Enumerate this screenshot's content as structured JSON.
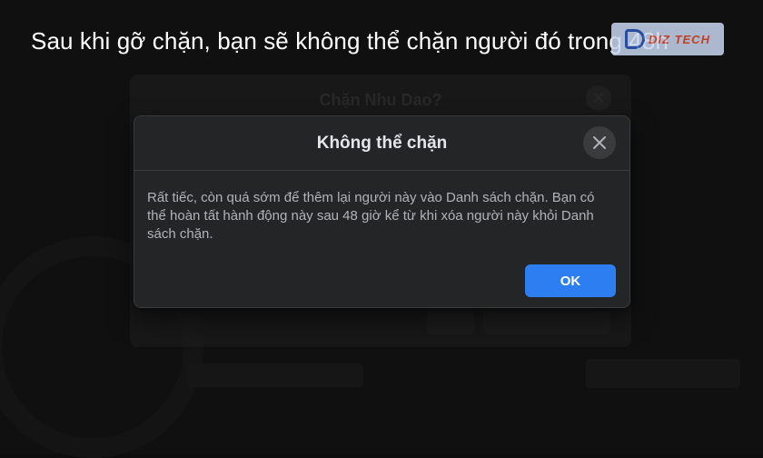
{
  "caption": "Sau khi gỡ chặn, bạn sẽ không thể chặn người đó trong 48h",
  "logo": {
    "text": "DIZ TECH"
  },
  "background": {
    "dialog_title": "Chặn Nhu Dao?",
    "close_glyph": "✕"
  },
  "dialog": {
    "title": "Không thể chặn",
    "close_icon": "close-icon",
    "message": "Rất tiếc, còn quá sớm để thêm lại người này vào Danh sách chặn. Bạn có thể hoàn tất hành động này sau 48 giờ kể từ khi xóa người này khỏi Danh sách chặn.",
    "ok_label": "OK"
  },
  "colors": {
    "accent": "#2d7ef0",
    "dialog_bg": "#242526",
    "text_primary": "#e4e6eb",
    "text_secondary": "#b0b3b8"
  }
}
